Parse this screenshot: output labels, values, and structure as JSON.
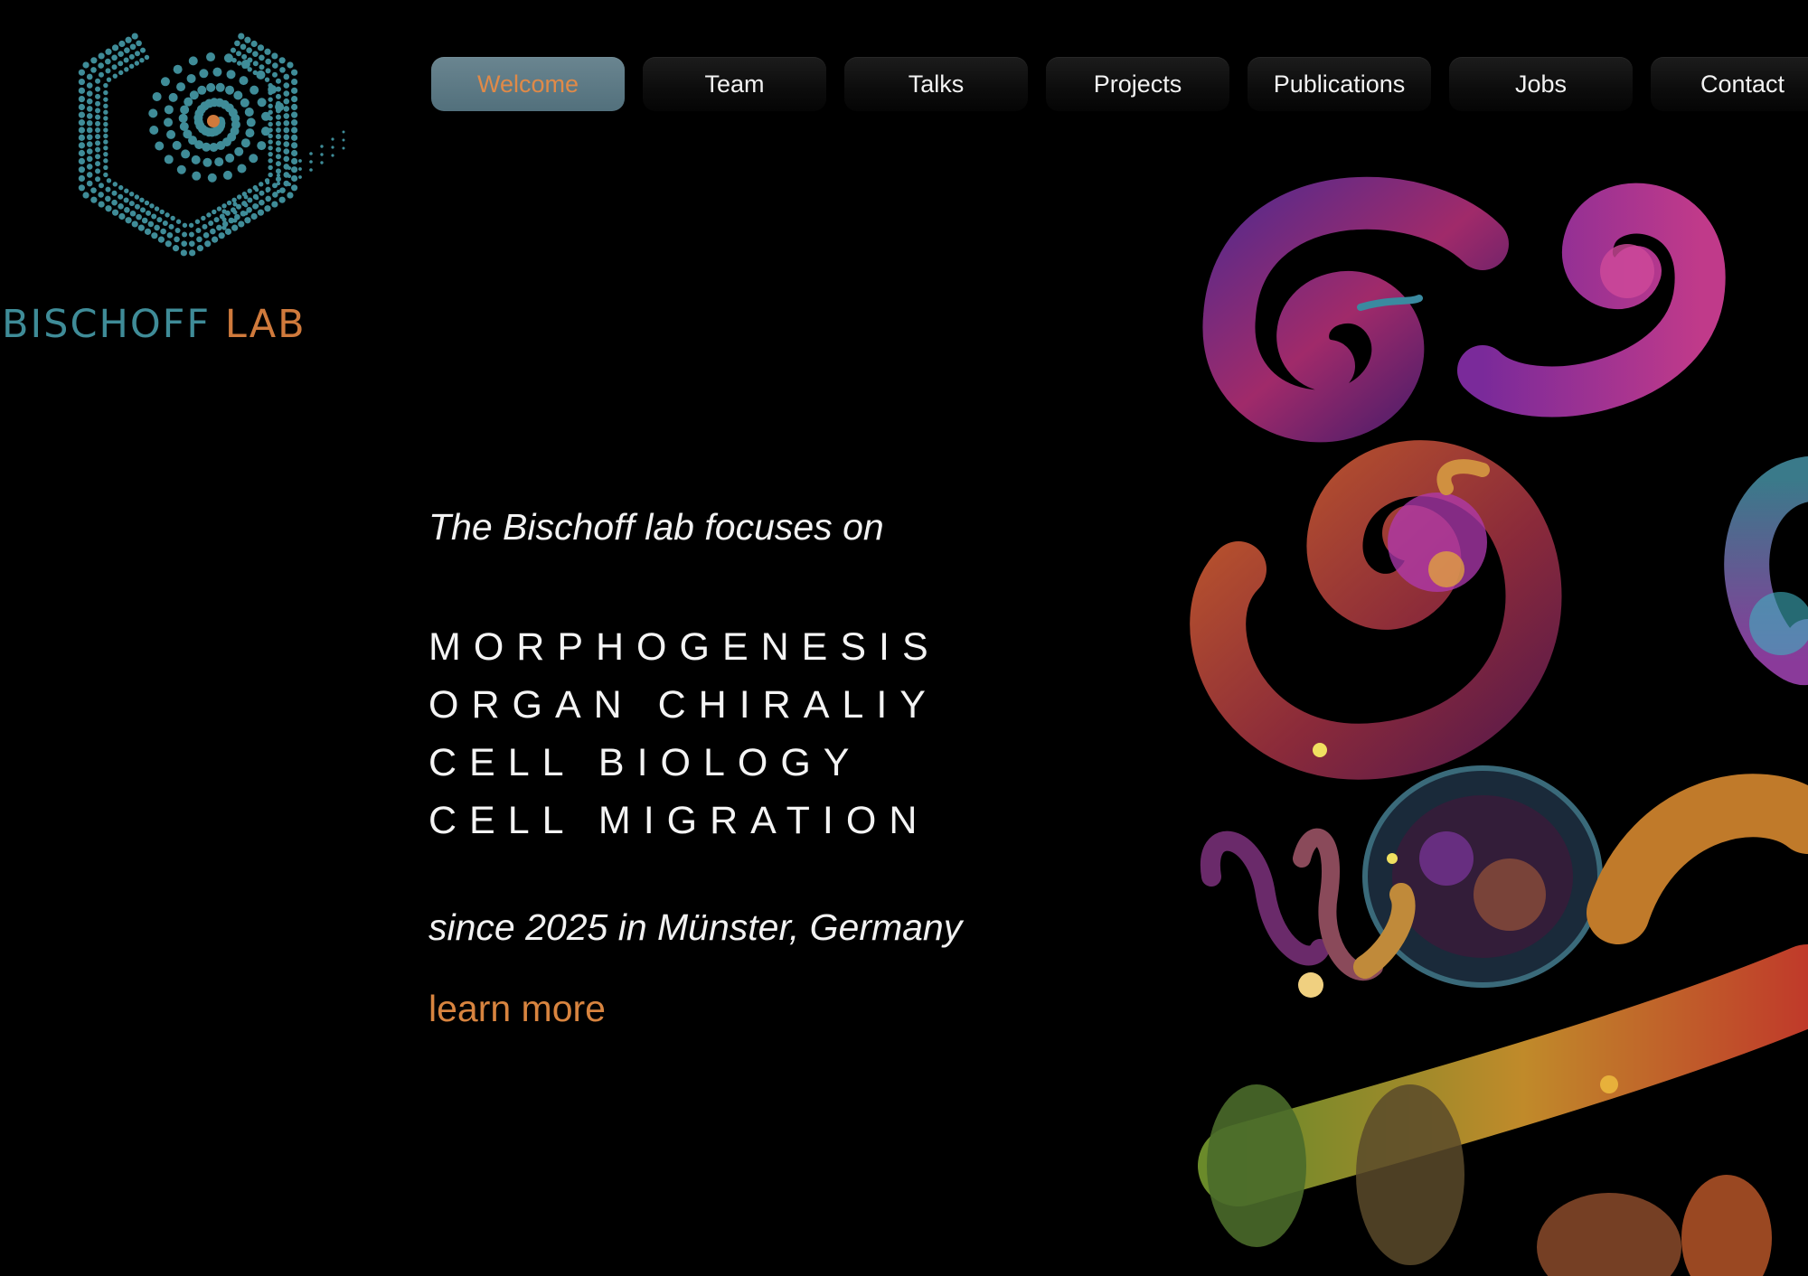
{
  "logo": {
    "word1": "BISCHOFF",
    "word2": "LAB",
    "icon": "dotted-spiral-hexagon-icon",
    "colors": {
      "teal": "#3f8c98",
      "orange": "#d07a3c"
    }
  },
  "nav": {
    "items": [
      {
        "label": "Welcome",
        "active": true
      },
      {
        "label": "Team"
      },
      {
        "label": "Talks"
      },
      {
        "label": "Projects"
      },
      {
        "label": "Publications"
      },
      {
        "label": "Jobs"
      },
      {
        "label": "Contact"
      }
    ]
  },
  "hero": {
    "intro": "The Bischoff lab focuses on",
    "topics": [
      "MORPHOGENESIS",
      "ORGAN CHIRALIY",
      "CELL BIOLOGY",
      "CELL MIGRATION"
    ],
    "since": "since 2025 in Münster, Germany",
    "learn_more": "learn more",
    "accent_color": "#d8843f"
  },
  "image": {
    "description_icon": "fluorescent-gut-tissue-image"
  }
}
